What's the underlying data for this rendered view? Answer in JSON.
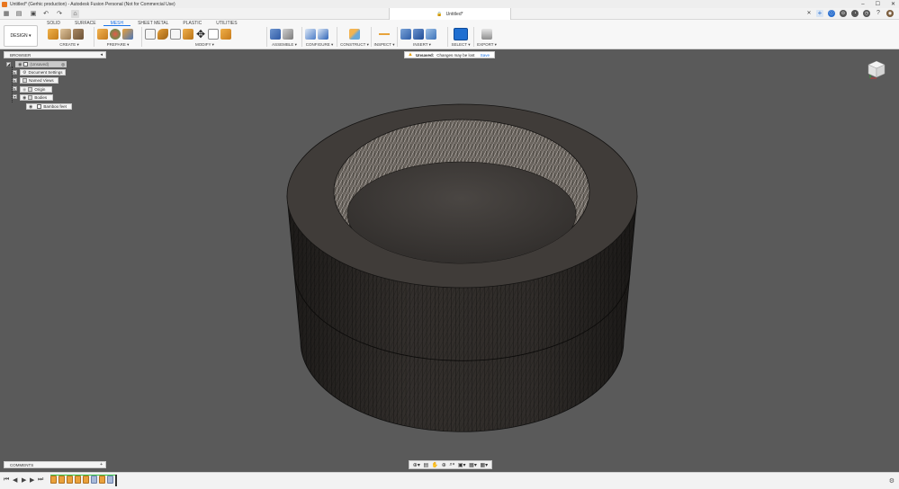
{
  "titlebar": {
    "title": "Untitled* (Gerhic production) - Autodesk Fusion Personal (Not for Commercial Use)",
    "minimize": "–",
    "maximize": "☐",
    "close": "✕"
  },
  "qat": {
    "grid_icon": "▦",
    "file_icon": "▤",
    "save_icon": "▣",
    "undo_icon": "↶",
    "redo_icon": "↷",
    "home_icon": "⌂",
    "doc_tab_label": "Untitled*",
    "doc_tab_lock": "🔒",
    "doc_tab_close": "✕",
    "new_tab": "+",
    "icons": [
      "ⓘ",
      "⊙",
      "◔",
      "◷",
      "?",
      "◉"
    ]
  },
  "ribbon": {
    "workspace": "DESIGN ▾",
    "tabs": [
      "SOLID",
      "SURFACE",
      "MESH",
      "SHEET METAL",
      "PLASTIC",
      "UTILITIES"
    ],
    "active_tab": "MESH",
    "groups": {
      "create": "CREATE ▾",
      "prepare": "PREPARE ▾",
      "modify": "MODIFY ▾",
      "assemble": "ASSEMBLE ▾",
      "configure": "CONFIGURE ▾",
      "construct": "CONSTRUCT ▾",
      "inspect": "INSPECT ▾",
      "insert": "INSERT ▾",
      "select": "SELECT ▾",
      "export": "EXPORT ▾"
    }
  },
  "notification": {
    "label": "Unsaved:",
    "message": "Changes may be lost",
    "action": "Save"
  },
  "browser": {
    "header": "BROWSER",
    "collapse_icon": "◂",
    "root": "(Unsaved)",
    "items": [
      "Document Settings",
      "Named Views",
      "Origin",
      "Bodies"
    ],
    "body_item": "Bamboo feet"
  },
  "comments": {
    "header": "COMMENTS",
    "add": "+"
  },
  "navbar": {
    "icons": [
      "⊕▾",
      "▤",
      "✋",
      "⊕",
      "⌕▾",
      "▣▾",
      "▦▾",
      "▦▾"
    ]
  },
  "timeline": {
    "first": "⏮",
    "prev": "◀",
    "play": "▶",
    "next": "▶",
    "last": "⏭",
    "gear": "⚙"
  },
  "colors": {
    "accent": "#1a73e8",
    "viewport_bg": "#5a5a5a",
    "model": "#3a3633",
    "timeline_progress": "#3cc94a"
  }
}
